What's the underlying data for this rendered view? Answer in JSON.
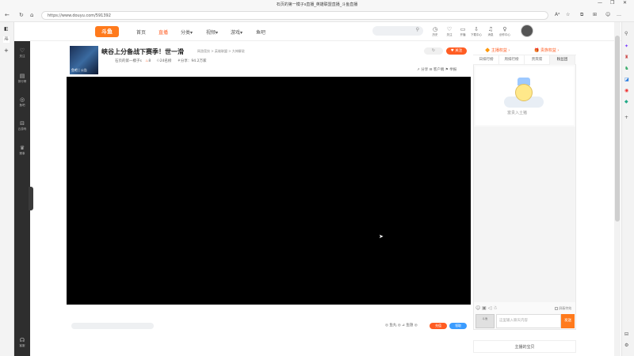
{
  "browser": {
    "window_title": "石页的第一模子s直播_英雄联盟直播_斗鱼直播",
    "url": "https://www.douyu.com/591392",
    "window_controls": [
      "—",
      "❐",
      "✕"
    ]
  },
  "header": {
    "logo_text": "斗鱼",
    "nav": [
      {
        "label": "首页"
      },
      {
        "label": "直播"
      },
      {
        "label": "分类▾"
      },
      {
        "label": "视频▾"
      },
      {
        "label": "游戏▾"
      },
      {
        "label": "鱼吧"
      }
    ],
    "search_placeholder": "",
    "icons": [
      {
        "icon": "history-icon",
        "label": "历史"
      },
      {
        "icon": "heart-icon",
        "label": "关注"
      },
      {
        "icon": "camera-icon",
        "label": "开播"
      },
      {
        "icon": "download-icon",
        "label": "下载中心"
      },
      {
        "icon": "bell-icon",
        "label": "消息"
      },
      {
        "icon": "bulb-icon",
        "label": "创作中心"
      }
    ]
  },
  "left_sidebar": [
    {
      "icon": "heart-icon",
      "label": "关注"
    },
    {
      "icon": "list-icon",
      "label": "排行榜"
    },
    {
      "icon": "fish-icon",
      "label": "鱼吧"
    },
    {
      "icon": "gamepad-icon",
      "label": "云游戏"
    },
    {
      "icon": "trophy-icon",
      "label": "赛事"
    },
    {
      "icon": "headset-icon",
      "label": "客服"
    }
  ],
  "room": {
    "thumb_label": "鱼吧 | 公告",
    "title": "峡谷上分备战下赛季！世一滑",
    "category": "网游竞技 > 英雄联盟 > 大神解说",
    "streamer": "石页的第一模子s",
    "hot": "8",
    "rank": "24名榜",
    "share_count": "分享：94.2万家",
    "follow_ghost": "↻",
    "follow_label": "♥ 关注",
    "actions": "↗ 分享   ⊟ 客户端   ⚑ 举报"
  },
  "video": {
    "cursor": "➤"
  },
  "under_video": {
    "right_text": "◎ 鱼丸  ◎  ⊿ 鱼翅  ◎",
    "btn_orange": "充值",
    "btn_blue": "领取"
  },
  "right_panel": {
    "top_items": [
      "🔶 主播权益 ›",
      "🎁 贵族权益 ›"
    ],
    "tabs": [
      "日排行榜",
      "周排行榜",
      "贵宾席",
      "粉丝团"
    ],
    "ad_caption": "富贵入土猪",
    "toolbar": "☺ ▣ ◁ ☃",
    "block_label": "屏蔽特效",
    "avatar_label": "斗鱼",
    "input_placeholder": "这里输入聊天内容",
    "send_label": "发送",
    "bottom_label": "主播的宝贝"
  }
}
